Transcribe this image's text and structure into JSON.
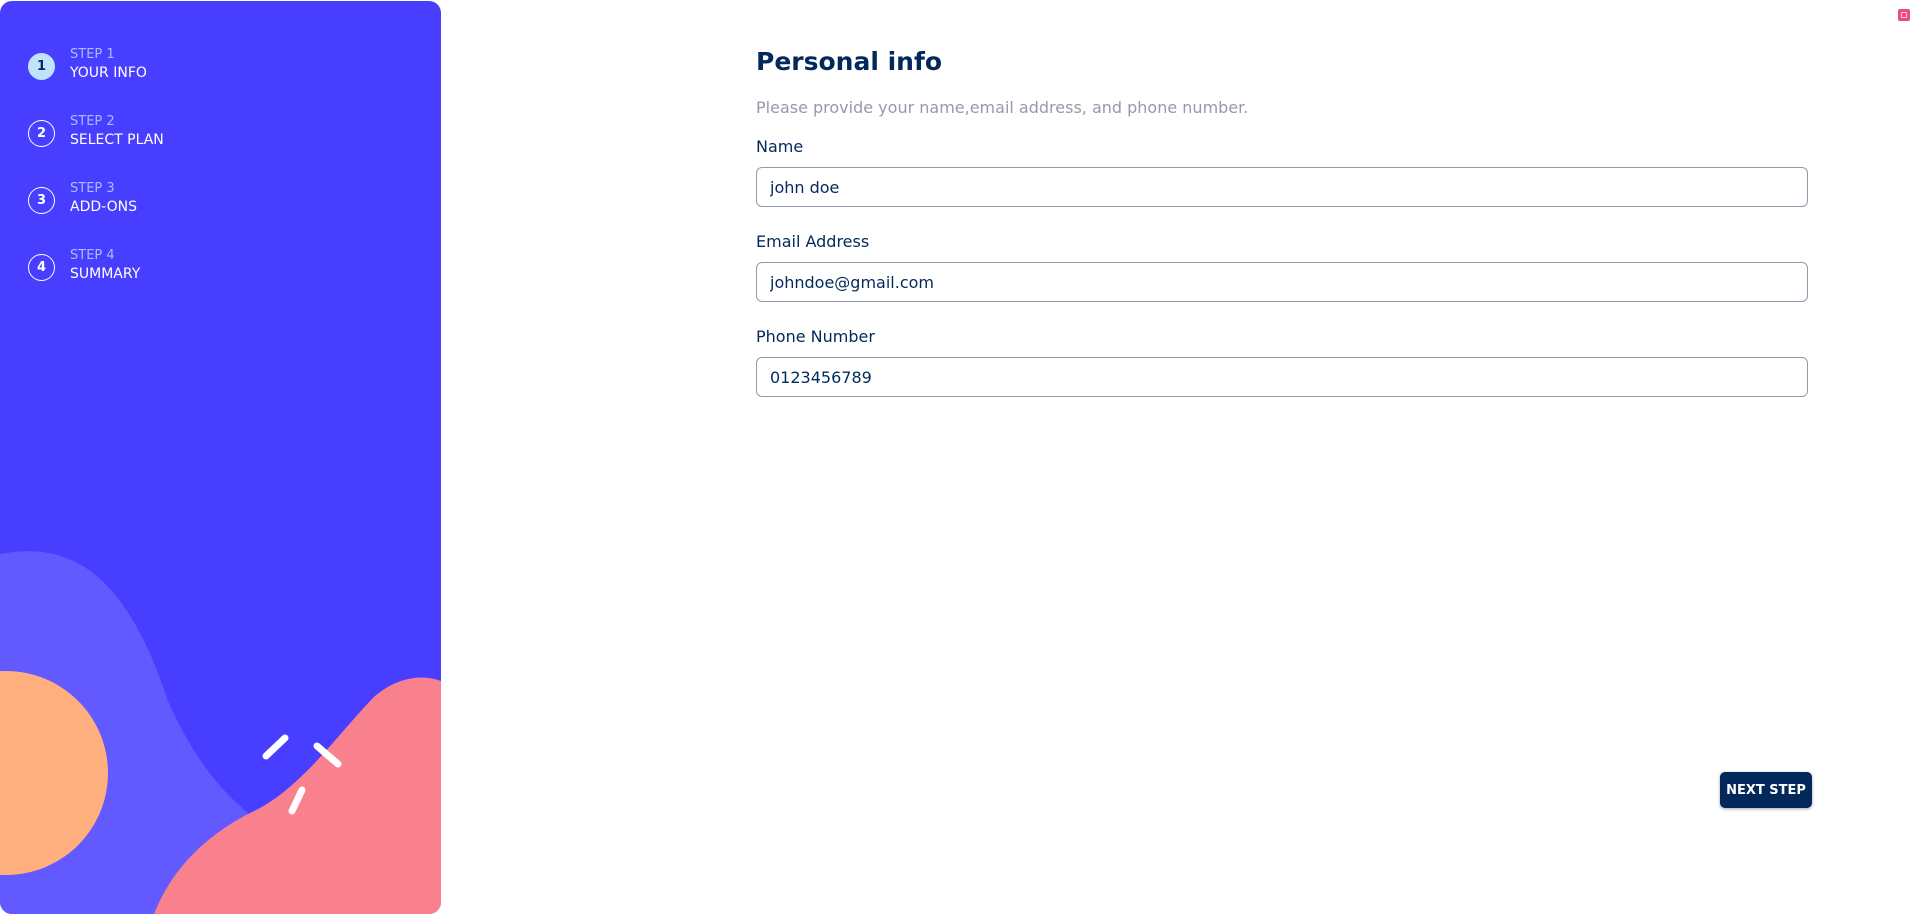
{
  "colors": {
    "sidebar_bg": "#483eff",
    "sidebar_shape_light": "#6259ff",
    "sidebar_shape_orange": "#ffaf7e",
    "sidebar_shape_pink": "#f9818e",
    "active_step_bg": "#bfe2fd",
    "primary_text": "#02295a",
    "muted_text": "#9699ab",
    "button_bg": "#02295a"
  },
  "sidebar": {
    "steps": [
      {
        "number": "1",
        "kicker": "STEP 1",
        "title": "YOUR INFO",
        "active": true
      },
      {
        "number": "2",
        "kicker": "STEP 2",
        "title": "SELECT PLAN",
        "active": false
      },
      {
        "number": "3",
        "kicker": "STEP 3",
        "title": "ADD-ONS",
        "active": false
      },
      {
        "number": "4",
        "kicker": "STEP 4",
        "title": "SUMMARY",
        "active": false
      }
    ]
  },
  "form": {
    "title": "Personal info",
    "subtitle": "Please provide your name,email address, and phone number.",
    "fields": [
      {
        "label": "Name",
        "value": "john doe"
      },
      {
        "label": "Email Address",
        "value": "johndoe@gmail.com"
      },
      {
        "label": "Phone Number",
        "value": "0123456789"
      }
    ],
    "next_label": "NEXT STEP"
  },
  "corner_icon": "small-square-icon"
}
